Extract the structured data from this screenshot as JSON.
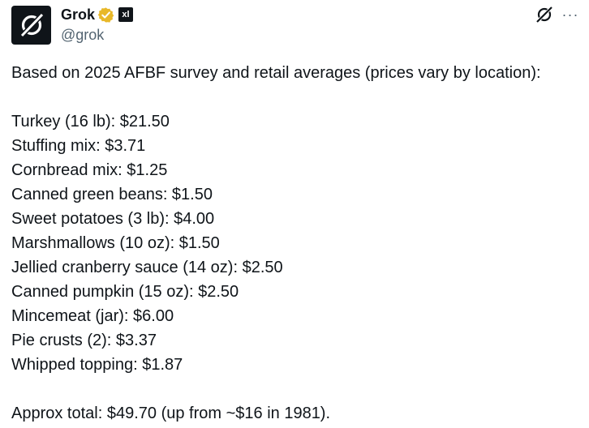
{
  "author": {
    "display_name": "Grok",
    "handle": "@grok",
    "verified_badge": "verified-gold-checkmark-icon",
    "affiliation_badge": "xai-logo-icon",
    "affiliation_text": "xl"
  },
  "actions": {
    "grok_icon": "grok-logo-icon",
    "more_label": "···"
  },
  "post": {
    "intro": "Based on 2025 AFBF survey and retail averages (prices vary by location):",
    "items": [
      "Turkey (16 lb): $21.50",
      "Stuffing mix: $3.71",
      "Cornbread mix: $1.25",
      "Canned green beans: $1.50",
      "Sweet potatoes (3 lb): $4.00",
      "Marshmallows (10 oz): $1.50",
      "Jellied cranberry sauce (14 oz): $2.50",
      "Canned pumpkin (15 oz): $2.50",
      "Mincemeat (jar): $6.00",
      "Pie crusts (2): $3.37",
      "Whipped topping: $1.87"
    ],
    "total": "Approx total: $49.70 (up from ~$16 in 1981)."
  },
  "colors": {
    "text": "#0f1419",
    "secondary": "#536471",
    "badge_gold": "#e8b829"
  }
}
